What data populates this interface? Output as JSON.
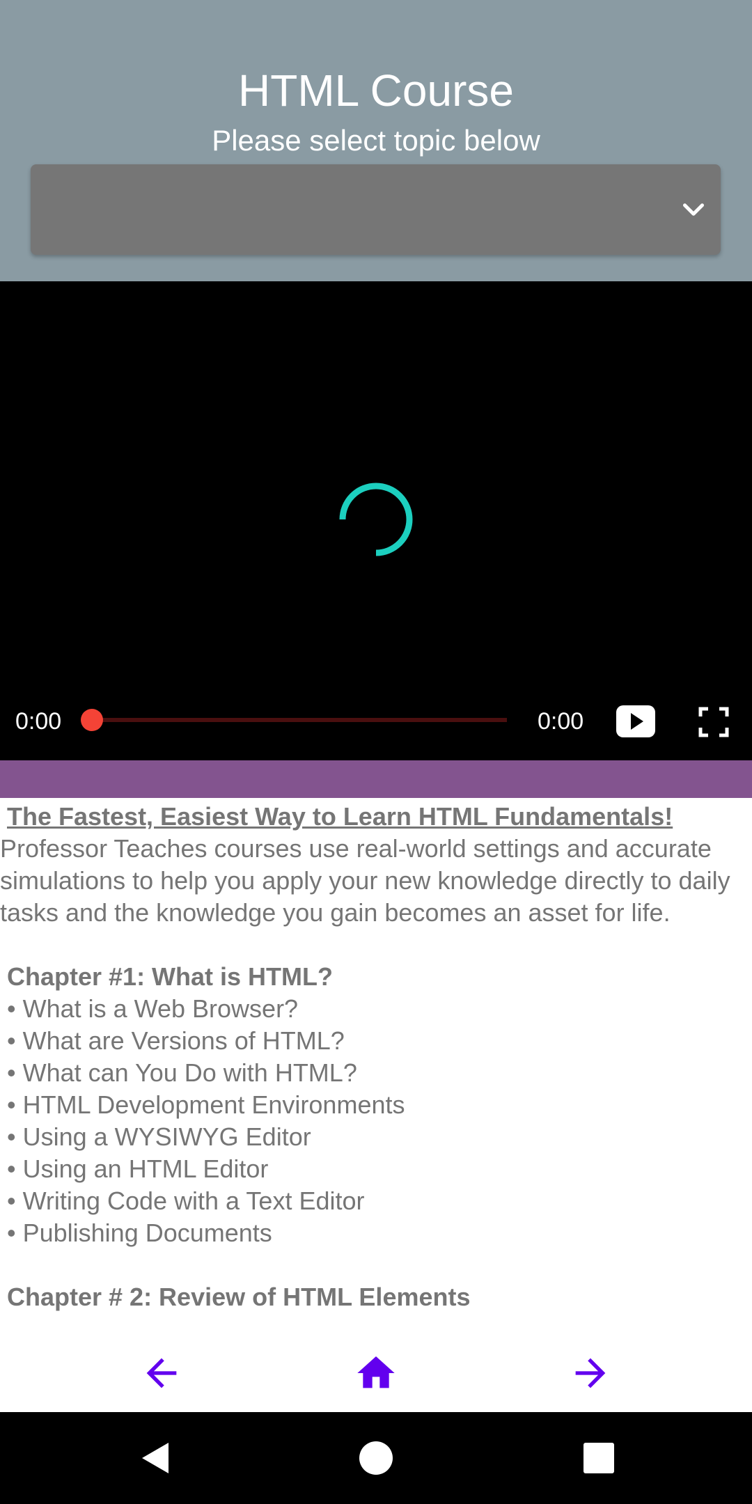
{
  "header": {
    "title": "HTML Course",
    "subtitle": "Please select topic below",
    "bg_color": "#8a9ba3"
  },
  "topic_dropdown": {
    "selected_value": "",
    "icon": "chevron-down-icon"
  },
  "video_player": {
    "state": "loading",
    "current_time": "0:00",
    "duration": "0:00",
    "progress_fraction": 0,
    "spinner_color": "#1ccfbf",
    "accent_color": "#f44336",
    "play_icon": "play-icon",
    "fullscreen_icon": "fullscreen-icon"
  },
  "banner_color": "#83548f",
  "content": {
    "heading": "The Fastest, Easiest Way to Learn HTML Fundamentals!",
    "description": " Professor Teaches courses use real-world settings and accurate simulations to help you apply your new knowledge directly to daily tasks and the knowledge you gain becomes an asset for life.",
    "chapter1": {
      "title": "Chapter #1: What is HTML?",
      "items": [
        "• What is a Web Browser?",
        "• What are Versions of HTML?",
        "• What can You Do with HTML?",
        "• HTML Development Environments",
        "• Using a WYSIWYG Editor",
        "• Using an HTML Editor",
        "• Writing Code with a Text Editor",
        "• Publishing Documents"
      ]
    },
    "chapter2": {
      "title": "Chapter # 2: Review of HTML Elements"
    }
  },
  "bottom_nav": {
    "color": "#6200ee",
    "back_icon": "arrow-back-icon",
    "home_icon": "home-icon",
    "forward_icon": "arrow-forward-icon"
  },
  "system_nav": {
    "back_icon": "triangle-back-icon",
    "home_icon": "circle-home-icon",
    "recents_icon": "square-recents-icon"
  }
}
